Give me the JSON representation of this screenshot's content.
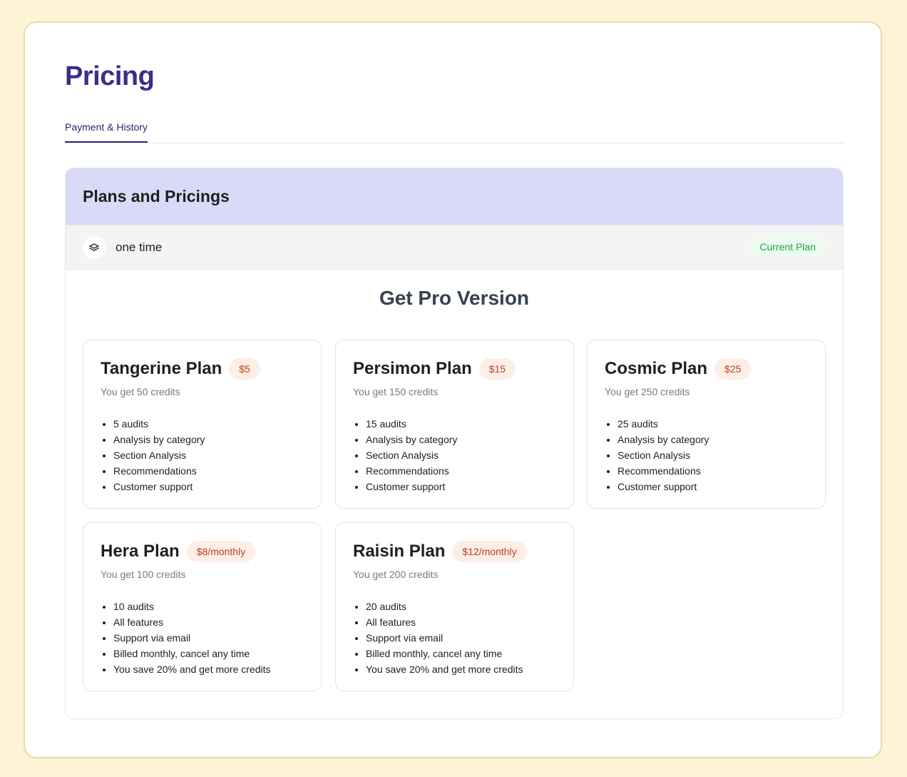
{
  "page": {
    "title": "Pricing"
  },
  "tabs": [
    {
      "label": "Payment & History",
      "active": true
    }
  ],
  "panel": {
    "title": "Plans and Pricings",
    "current_plan": {
      "icon": "layers-icon",
      "name": "one time",
      "badge": "Current Plan"
    },
    "section_title": "Get Pro Version"
  },
  "plans": [
    {
      "name": "Tangerine Plan",
      "price": "$5",
      "credits": "You get 50 credits",
      "features": [
        "5 audits",
        "Analysis by category",
        "Section Analysis",
        "Recommendations",
        "Customer support"
      ]
    },
    {
      "name": "Persimon Plan",
      "price": "$15",
      "credits": "You get 150 credits",
      "features": [
        "15 audits",
        "Analysis by category",
        "Section Analysis",
        "Recommendations",
        "Customer support"
      ]
    },
    {
      "name": "Cosmic Plan",
      "price": "$25",
      "credits": "You get 250 credits",
      "features": [
        "25 audits",
        "Analysis by category",
        "Section Analysis",
        "Recommendations",
        "Customer support"
      ]
    },
    {
      "name": "Hera Plan",
      "price": "$8/monthly",
      "credits": "You get 100 credits",
      "features": [
        "10 audits",
        "All features",
        "Support via email",
        "Billed monthly, cancel any time",
        "You save 20% and get more credits"
      ]
    },
    {
      "name": "Raisin Plan",
      "price": "$12/monthly",
      "credits": "You get 200 credits",
      "features": [
        "20 audits",
        "All features",
        "Support via email",
        "Billed monthly, cancel any time",
        "You save 20% and get more credits"
      ]
    }
  ],
  "colors": {
    "background": "#fdf3d6",
    "title": "#3b2e8a",
    "panel_header": "#d9daf8",
    "current_badge_text": "#20a548",
    "price_badge_text": "#b9401f",
    "price_badge_bg": "#fdeee6"
  }
}
